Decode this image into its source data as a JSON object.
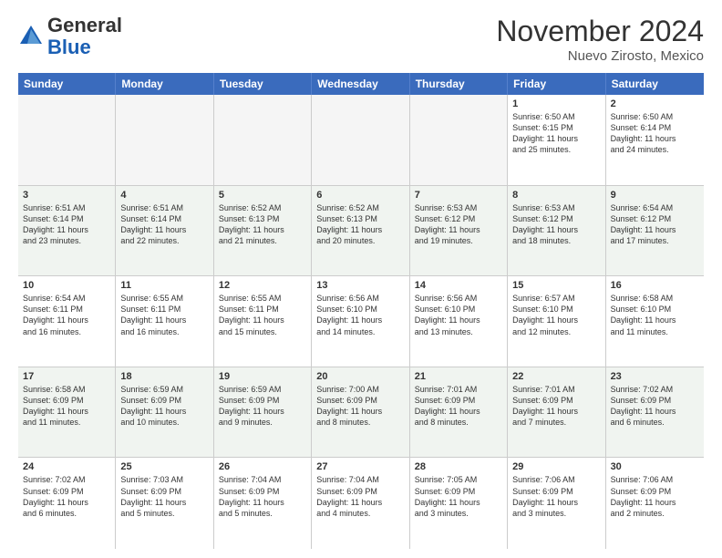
{
  "header": {
    "logo_general": "General",
    "logo_blue": "Blue",
    "month_title": "November 2024",
    "location": "Nuevo Zirosto, Mexico"
  },
  "days_of_week": [
    "Sunday",
    "Monday",
    "Tuesday",
    "Wednesday",
    "Thursday",
    "Friday",
    "Saturday"
  ],
  "weeks": [
    [
      {
        "day": "",
        "empty": true
      },
      {
        "day": "",
        "empty": true
      },
      {
        "day": "",
        "empty": true
      },
      {
        "day": "",
        "empty": true
      },
      {
        "day": "",
        "empty": true
      },
      {
        "day": "1",
        "text": "Sunrise: 6:50 AM\nSunset: 6:15 PM\nDaylight: 11 hours\nand 25 minutes."
      },
      {
        "day": "2",
        "text": "Sunrise: 6:50 AM\nSunset: 6:14 PM\nDaylight: 11 hours\nand 24 minutes."
      }
    ],
    [
      {
        "day": "3",
        "text": "Sunrise: 6:51 AM\nSunset: 6:14 PM\nDaylight: 11 hours\nand 23 minutes."
      },
      {
        "day": "4",
        "text": "Sunrise: 6:51 AM\nSunset: 6:14 PM\nDaylight: 11 hours\nand 22 minutes."
      },
      {
        "day": "5",
        "text": "Sunrise: 6:52 AM\nSunset: 6:13 PM\nDaylight: 11 hours\nand 21 minutes."
      },
      {
        "day": "6",
        "text": "Sunrise: 6:52 AM\nSunset: 6:13 PM\nDaylight: 11 hours\nand 20 minutes."
      },
      {
        "day": "7",
        "text": "Sunrise: 6:53 AM\nSunset: 6:12 PM\nDaylight: 11 hours\nand 19 minutes."
      },
      {
        "day": "8",
        "text": "Sunrise: 6:53 AM\nSunset: 6:12 PM\nDaylight: 11 hours\nand 18 minutes."
      },
      {
        "day": "9",
        "text": "Sunrise: 6:54 AM\nSunset: 6:12 PM\nDaylight: 11 hours\nand 17 minutes."
      }
    ],
    [
      {
        "day": "10",
        "text": "Sunrise: 6:54 AM\nSunset: 6:11 PM\nDaylight: 11 hours\nand 16 minutes."
      },
      {
        "day": "11",
        "text": "Sunrise: 6:55 AM\nSunset: 6:11 PM\nDaylight: 11 hours\nand 16 minutes."
      },
      {
        "day": "12",
        "text": "Sunrise: 6:55 AM\nSunset: 6:11 PM\nDaylight: 11 hours\nand 15 minutes."
      },
      {
        "day": "13",
        "text": "Sunrise: 6:56 AM\nSunset: 6:10 PM\nDaylight: 11 hours\nand 14 minutes."
      },
      {
        "day": "14",
        "text": "Sunrise: 6:56 AM\nSunset: 6:10 PM\nDaylight: 11 hours\nand 13 minutes."
      },
      {
        "day": "15",
        "text": "Sunrise: 6:57 AM\nSunset: 6:10 PM\nDaylight: 11 hours\nand 12 minutes."
      },
      {
        "day": "16",
        "text": "Sunrise: 6:58 AM\nSunset: 6:10 PM\nDaylight: 11 hours\nand 11 minutes."
      }
    ],
    [
      {
        "day": "17",
        "text": "Sunrise: 6:58 AM\nSunset: 6:09 PM\nDaylight: 11 hours\nand 11 minutes."
      },
      {
        "day": "18",
        "text": "Sunrise: 6:59 AM\nSunset: 6:09 PM\nDaylight: 11 hours\nand 10 minutes."
      },
      {
        "day": "19",
        "text": "Sunrise: 6:59 AM\nSunset: 6:09 PM\nDaylight: 11 hours\nand 9 minutes."
      },
      {
        "day": "20",
        "text": "Sunrise: 7:00 AM\nSunset: 6:09 PM\nDaylight: 11 hours\nand 8 minutes."
      },
      {
        "day": "21",
        "text": "Sunrise: 7:01 AM\nSunset: 6:09 PM\nDaylight: 11 hours\nand 8 minutes."
      },
      {
        "day": "22",
        "text": "Sunrise: 7:01 AM\nSunset: 6:09 PM\nDaylight: 11 hours\nand 7 minutes."
      },
      {
        "day": "23",
        "text": "Sunrise: 7:02 AM\nSunset: 6:09 PM\nDaylight: 11 hours\nand 6 minutes."
      }
    ],
    [
      {
        "day": "24",
        "text": "Sunrise: 7:02 AM\nSunset: 6:09 PM\nDaylight: 11 hours\nand 6 minutes."
      },
      {
        "day": "25",
        "text": "Sunrise: 7:03 AM\nSunset: 6:09 PM\nDaylight: 11 hours\nand 5 minutes."
      },
      {
        "day": "26",
        "text": "Sunrise: 7:04 AM\nSunset: 6:09 PM\nDaylight: 11 hours\nand 5 minutes."
      },
      {
        "day": "27",
        "text": "Sunrise: 7:04 AM\nSunset: 6:09 PM\nDaylight: 11 hours\nand 4 minutes."
      },
      {
        "day": "28",
        "text": "Sunrise: 7:05 AM\nSunset: 6:09 PM\nDaylight: 11 hours\nand 3 minutes."
      },
      {
        "day": "29",
        "text": "Sunrise: 7:06 AM\nSunset: 6:09 PM\nDaylight: 11 hours\nand 3 minutes."
      },
      {
        "day": "30",
        "text": "Sunrise: 7:06 AM\nSunset: 6:09 PM\nDaylight: 11 hours\nand 2 minutes."
      }
    ]
  ]
}
